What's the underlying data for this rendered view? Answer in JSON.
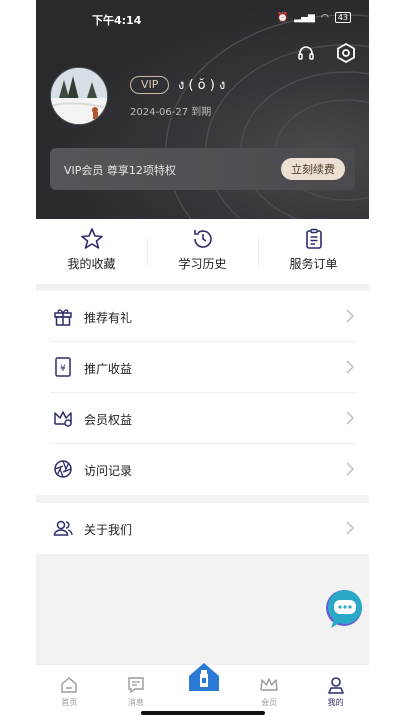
{
  "status_bar": {
    "time": "下午4:14",
    "battery": "43"
  },
  "profile": {
    "vip_label": "VIP",
    "nickname": "ง ( ŏ ) ง",
    "expiry": "2024-06-27 到期"
  },
  "vip_banner": {
    "text": "VIP会员  尊享12项特权",
    "button": "立刻续费"
  },
  "quick_actions": [
    {
      "label": "我的收藏",
      "icon": "star-icon"
    },
    {
      "label": "学习历史",
      "icon": "history-icon"
    },
    {
      "label": "服务订单",
      "icon": "clipboard-icon"
    }
  ],
  "menu": [
    {
      "label": "推荐有礼",
      "icon": "gift-icon"
    },
    {
      "label": "推广收益",
      "icon": "yuan-icon"
    },
    {
      "label": "会员权益",
      "icon": "crown-icon"
    },
    {
      "label": "访问记录",
      "icon": "aperture-icon"
    }
  ],
  "menu2": [
    {
      "label": "关于我们",
      "icon": "people-icon"
    }
  ],
  "tabs": [
    {
      "label": "首页",
      "icon": "home-icon"
    },
    {
      "label": "消息",
      "icon": "message-icon"
    },
    {
      "label": "",
      "icon": "bottle-home-icon"
    },
    {
      "label": "会员",
      "icon": "crown-icon"
    },
    {
      "label": "我的",
      "icon": "person-icon",
      "active": true
    }
  ],
  "colors": {
    "accent": "#2d2d6b",
    "header_bg": "#2f2f33",
    "vip_button_bg": "#ece0d2",
    "chat_teal": "#2aa9c6"
  }
}
